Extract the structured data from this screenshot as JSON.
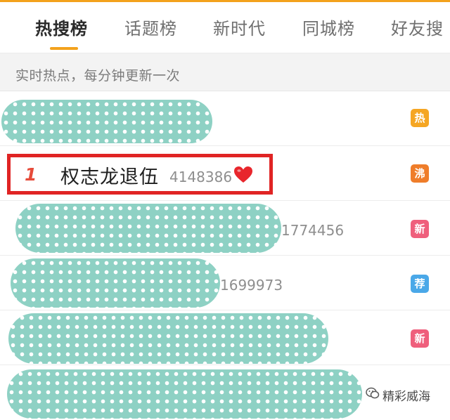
{
  "tabs": [
    {
      "label": "热搜榜",
      "active": true
    },
    {
      "label": "话题榜"
    },
    {
      "label": "新时代"
    },
    {
      "label": "同城榜"
    },
    {
      "label": "好友搜"
    }
  ],
  "subheader": "实时热点，每分钟更新一次",
  "rows": [
    {
      "badge": "热",
      "badge_color": "#f5a623",
      "count": ""
    },
    {
      "rank": "1",
      "title": "权志龙退伍",
      "count": "4148386",
      "badge": "沸",
      "badge_color": "#ef7d2a",
      "icon": "heart-icon"
    },
    {
      "badge": "新",
      "badge_color": "#ef5f7c",
      "count": "1774456"
    },
    {
      "badge": "荐",
      "badge_color": "#4aa8e8",
      "count": "1699973"
    },
    {
      "badge": "新",
      "badge_color": "#ef5f7c",
      "count": ""
    },
    {
      "count": ""
    }
  ],
  "watermark": {
    "label": "精彩威海",
    "icon": "wechat-icon"
  },
  "colors": {
    "accent": "#f3a21c",
    "highlight": "#e02424",
    "mask": "#8ed1c4"
  }
}
